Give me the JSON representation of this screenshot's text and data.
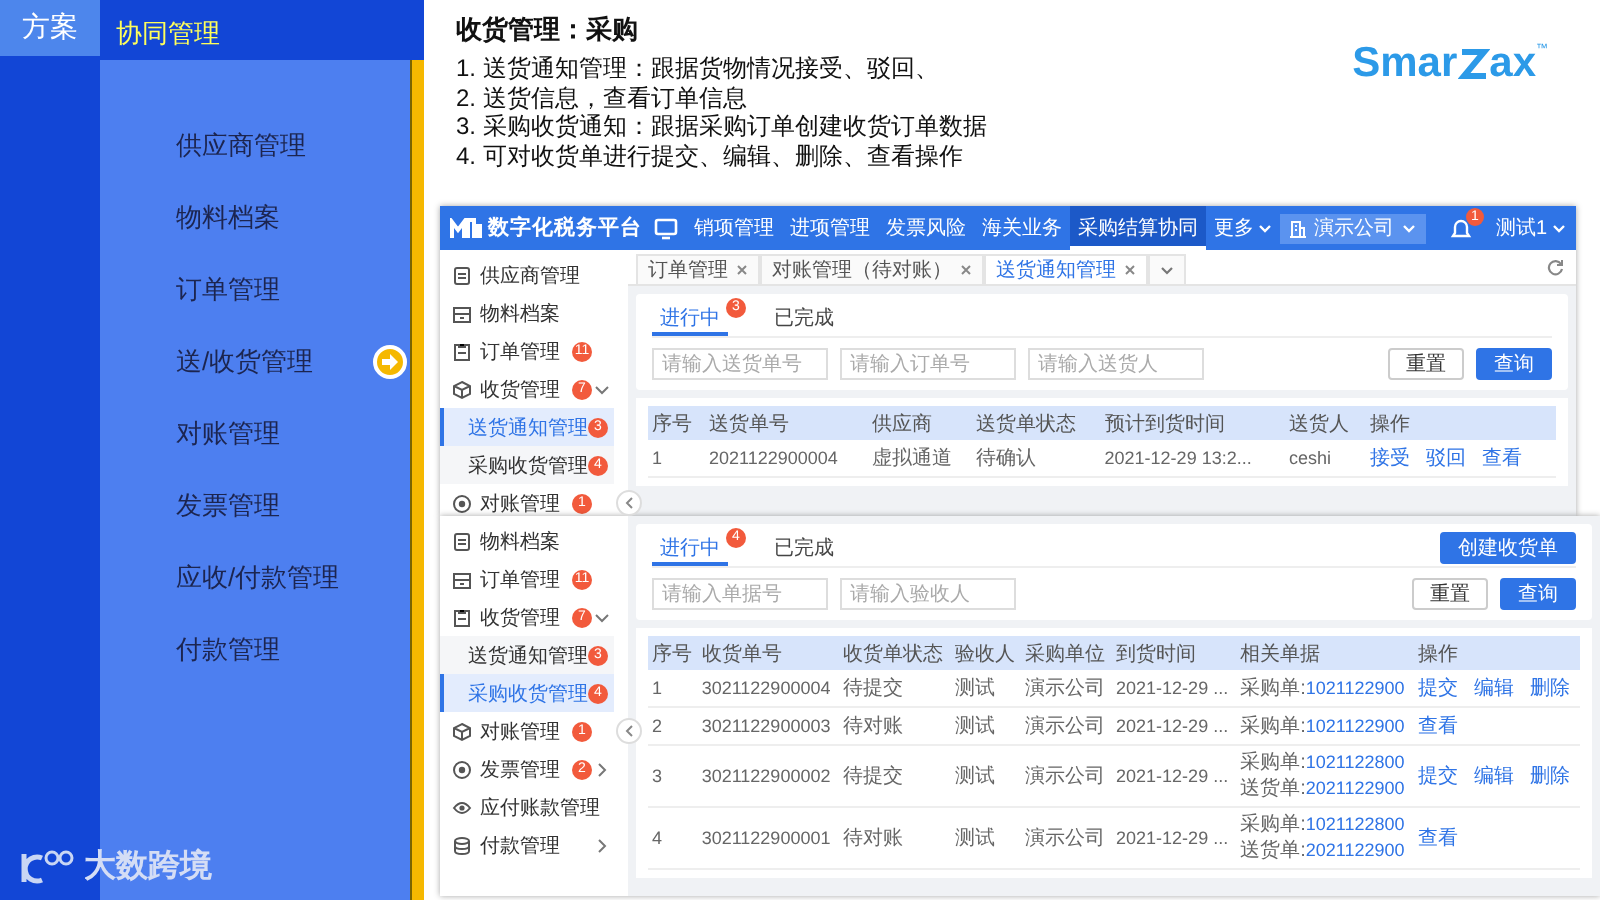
{
  "slide_nav": {
    "section_tab": "方案",
    "group_title": "协同管理",
    "items": [
      {
        "label": "供应商管理",
        "selected": false
      },
      {
        "label": "物料档案",
        "selected": false
      },
      {
        "label": "订单管理",
        "selected": false
      },
      {
        "label": "送/收货管理",
        "selected": true
      },
      {
        "label": "对账管理",
        "selected": false
      },
      {
        "label": "发票管理",
        "selected": false
      },
      {
        "label": "应收/付款管理",
        "selected": false
      },
      {
        "label": "付款管理",
        "selected": false
      }
    ],
    "brand": "大数跨境"
  },
  "heading": "收货管理：采购",
  "points": [
    "1. 送货通知管理：跟据货物情况接受、驳回、",
    "2. 送货信息，查看订单信息",
    "3. 采购收货通知：跟据采购订单创建收货订单数据",
    "4. 可对收货单进行提交、编辑、删除、查看操作"
  ],
  "product_logo": {
    "left": "Smar",
    "right": "ax",
    "trademark": "™"
  },
  "screenshots": [
    {
      "app_bar": {
        "title": "数字化税务平台",
        "nav": [
          {
            "label": "销项管理",
            "selected": false
          },
          {
            "label": "进项管理",
            "selected": false
          },
          {
            "label": "发票风险",
            "selected": false
          },
          {
            "label": "海关业务",
            "selected": false
          },
          {
            "label": "采购结算协同",
            "selected": true
          }
        ],
        "more": "更多",
        "company": "演示公司",
        "notifications": "1",
        "user": "测试1"
      },
      "sidebar": [
        {
          "label": "供应商管理",
          "selected": false
        },
        {
          "label": "物料档案",
          "selected": false
        },
        {
          "label": "订单管理",
          "badge": "11",
          "selected": false
        },
        {
          "label": "收货管理",
          "badge": "7",
          "expanded": true,
          "selected": false,
          "children": [
            {
              "label": "送货通知管理",
              "badge": "3",
              "selected": true
            },
            {
              "label": "采购收货管理",
              "badge": "4",
              "selected": false
            }
          ]
        },
        {
          "label": "对账管理",
          "badge": "1",
          "selected": false
        }
      ],
      "page_tabs": [
        {
          "label": "订单管理",
          "selected": false
        },
        {
          "label": "对账管理（待对账）",
          "selected": false
        },
        {
          "label": "送货通知管理",
          "selected": true
        }
      ],
      "status_tabs": [
        {
          "label": "进行中",
          "badge": "3",
          "selected": true
        },
        {
          "label": "已完成",
          "selected": false
        }
      ],
      "filters": [
        {
          "placeholder": "请输入送货单号"
        },
        {
          "placeholder": "请输入订单号"
        },
        {
          "placeholder": "请输入送货人"
        }
      ],
      "buttons": [
        {
          "label": "重置",
          "kind": "secondary"
        },
        {
          "label": "查询",
          "kind": "primary"
        }
      ],
      "table": {
        "columns": [
          "序号",
          "送货单号",
          "供应商",
          "送货单状态",
          "预计到货时间",
          "送货人",
          "操作"
        ],
        "rows": [
          {
            "cells": [
              "1",
              "2021122900004",
              "虚拟通道",
              "待确认",
              "2021-12-29 13:2...",
              "ceshi"
            ],
            "actions": [
              "接受",
              "驳回",
              "查看"
            ]
          }
        ]
      }
    },
    {
      "sidebar": [
        {
          "label": "物料档案",
          "selected": false
        },
        {
          "label": "订单管理",
          "badge": "11",
          "selected": false
        },
        {
          "label": "收货管理",
          "badge": "7",
          "expanded": true,
          "selected": false,
          "children": [
            {
              "label": "送货通知管理",
              "badge": "3",
              "selected": false
            },
            {
              "label": "采购收货管理",
              "badge": "4",
              "selected": true
            }
          ]
        },
        {
          "label": "对账管理",
          "badge": "1",
          "selected": false
        },
        {
          "label": "发票管理",
          "badge": "2",
          "expanded": false,
          "selected": false
        },
        {
          "label": "应付账款管理",
          "selected": false
        },
        {
          "label": "付款管理",
          "expanded": false,
          "selected": false
        }
      ],
      "status_tabs": [
        {
          "label": "进行中",
          "badge": "4",
          "selected": true
        },
        {
          "label": "已完成",
          "selected": false
        }
      ],
      "create_button": "创建收货单",
      "filters": [
        {
          "placeholder": "请输入单据号"
        },
        {
          "placeholder": "请输入验收人"
        }
      ],
      "buttons": [
        {
          "label": "重置",
          "kind": "secondary"
        },
        {
          "label": "查询",
          "kind": "primary"
        }
      ],
      "table": {
        "columns": [
          "序号",
          "收货单号",
          "收货单状态",
          "验收人",
          "采购单位",
          "到货时间",
          "相关单据",
          "操作"
        ],
        "rows": [
          {
            "cells": [
              "1",
              "3021122900004",
              "待提交",
              "测试",
              "演示公司",
              "2021-12-29 ..."
            ],
            "related": [
              {
                "label": "采购单:",
                "number": "1021122900"
              }
            ],
            "actions": [
              "提交",
              "编辑",
              "删除"
            ]
          },
          {
            "cells": [
              "2",
              "3021122900003",
              "待对账",
              "测试",
              "演示公司",
              "2021-12-29 ..."
            ],
            "related": [
              {
                "label": "采购单:",
                "number": "1021122900"
              }
            ],
            "actions": [
              "查看"
            ]
          },
          {
            "cells": [
              "3",
              "3021122900002",
              "待提交",
              "测试",
              "演示公司",
              "2021-12-29 ..."
            ],
            "related": [
              {
                "label": "采购单:",
                "number": "1021122800"
              },
              {
                "label": "送货单:",
                "number": "2021122900"
              }
            ],
            "actions": [
              "提交",
              "编辑",
              "删除"
            ]
          },
          {
            "cells": [
              "4",
              "3021122900001",
              "待对账",
              "测试",
              "演示公司",
              "2021-12-29 ..."
            ],
            "related": [
              {
                "label": "采购单:",
                "number": "1021122800"
              },
              {
                "label": "送货单:",
                "number": "2021122900"
              }
            ],
            "actions": [
              "查看"
            ]
          }
        ]
      }
    }
  ]
}
